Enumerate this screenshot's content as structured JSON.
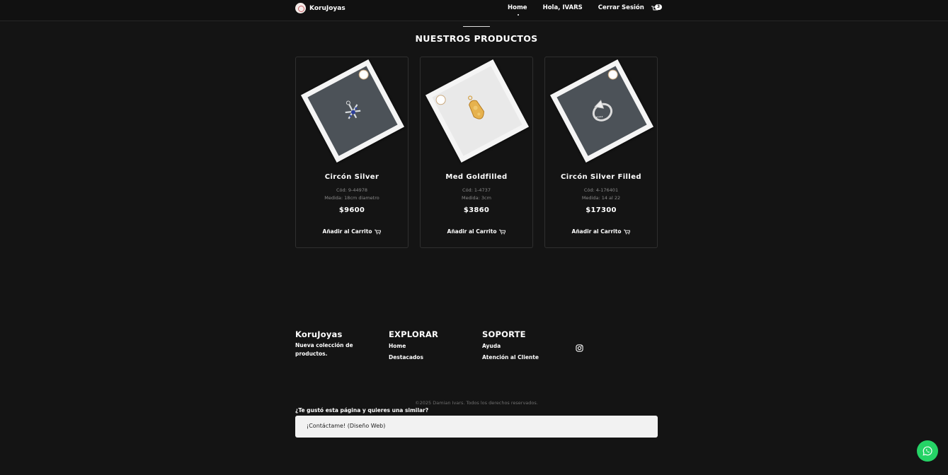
{
  "nav": {
    "brand": "KoruJoyas",
    "links": [
      "Home",
      "Hola, IVARS",
      "Cerrar Sesión"
    ],
    "cart_count": "3",
    "cart_icon": "cart-icon"
  },
  "section": {
    "title": "NUESTROS PRODUCTOS"
  },
  "products": [
    {
      "name": "Circón Silver",
      "code": "Cód: 9-44978",
      "size": "Medida: 18cm diametro",
      "price": "$9600",
      "button": "Añadir al Carrito"
    },
    {
      "name": "Med Goldfilled",
      "code": "Cód: 1-4737",
      "size": "Medida: 3cm",
      "price": "$3860",
      "button": "Añadir al Carrito"
    },
    {
      "name": "Circón Silver Filled",
      "code": "Cód: 4-176401",
      "size": "Medida: 14 al 22",
      "price": "$17300",
      "button": "Añadir al Carrito"
    }
  ],
  "footer": {
    "brand": {
      "title": "KoruJoyas",
      "text": "Nueva colección de productos."
    },
    "explorar": {
      "title": "EXPLORAR",
      "links": [
        "Home",
        "Destacados"
      ]
    },
    "soporte": {
      "title": "SOPORTE",
      "links": [
        "Ayuda",
        "Atención al Cliente"
      ]
    },
    "social_icon": "instagram-icon",
    "copyright": "©2025 Damian Ivars. Todos los derechos reservados.",
    "question": "¿Te gustó esta página y quieres una similar?",
    "contact": "¡Contáctame! (Diseño Web)"
  },
  "colors": {
    "background": "#141414",
    "whatsapp": "#25d366"
  }
}
